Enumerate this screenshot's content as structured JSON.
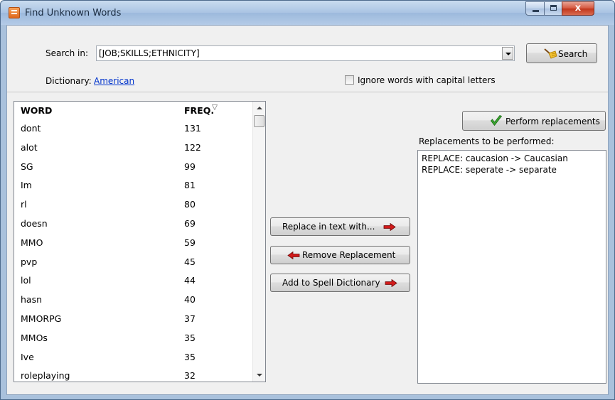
{
  "window": {
    "title": "Find Unknown Words",
    "close_glyph": "x"
  },
  "search": {
    "label": "Search in:",
    "value": "[JOB;SKILLS;ETHNICITY]",
    "button_label": "Search",
    "icon": "broom-icon"
  },
  "dictionary": {
    "label": "Dictionary:",
    "value": "American"
  },
  "ignore_caps": {
    "label": "Ignore words with capital letters",
    "checked": false
  },
  "wordlist": {
    "columns": [
      "WORD",
      "FREQ."
    ],
    "sort": "descending-by-freq",
    "rows": [
      {
        "word": "dont",
        "freq": "131"
      },
      {
        "word": "alot",
        "freq": "122"
      },
      {
        "word": "SG",
        "freq": "99"
      },
      {
        "word": "Im",
        "freq": "81"
      },
      {
        "word": "rl",
        "freq": "80"
      },
      {
        "word": "doesn",
        "freq": "69"
      },
      {
        "word": "MMO",
        "freq": "59"
      },
      {
        "word": "pvp",
        "freq": "45"
      },
      {
        "word": "lol",
        "freq": "44"
      },
      {
        "word": "hasn",
        "freq": "40"
      },
      {
        "word": "MMORPG",
        "freq": "37"
      },
      {
        "word": "MMOs",
        "freq": "35"
      },
      {
        "word": "Ive",
        "freq": "35"
      },
      {
        "word": "roleplaying",
        "freq": "32"
      }
    ]
  },
  "actions": {
    "replace_label": "Replace in text with...",
    "remove_label": "Remove Replacement",
    "add_label": "Add to Spell Dictionary",
    "arrow_color": "#d11a1a"
  },
  "replacements": {
    "perform_label": "Perform replacements",
    "list_label": "Replacements to be performed:",
    "items": [
      "REPLACE: caucasion -> Caucasian",
      "REPLACE: seperate -> separate"
    ]
  }
}
